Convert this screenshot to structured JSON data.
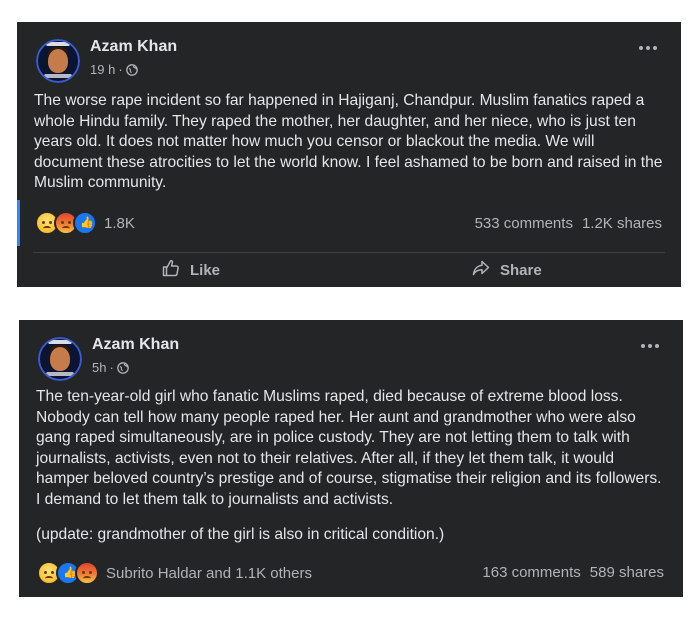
{
  "posts": [
    {
      "author": "Azam Khan",
      "time": "19 h",
      "separator": "·",
      "text": "The worse rape incident so far happened in Hajiganj, Chandpur. Muslim fanatics raped a whole Hindu family. They raped the mother, her daughter, and her niece, who is just ten years old. It does not matter how much you censor or blackout the media. We will document these atrocities to let the world know. I feel ashamed to be born and raised in the Muslim community.",
      "reaction_icons": [
        "sad-emoji-icon",
        "angry-emoji-icon",
        "like-emoji-icon"
      ],
      "reaction_count": "1.8K",
      "comments": "533 comments",
      "shares": "1.2K shares",
      "actions": {
        "like": "Like",
        "share": "Share"
      }
    },
    {
      "author": "Azam Khan",
      "time": "5h",
      "separator": "·",
      "text": "The ten-year-old girl who fanatic Muslims raped, died because of extreme blood loss. Nobody can tell how many people raped her. Her aunt and grandmother who were also gang raped simultaneously, are in police custody. They are not letting them to talk with journalists, activists, even not to their relatives. After all, if they let them talk, it would hamper beloved country’s prestige and of course, stigmatise their religion and its followers. I demand to let them talk to journalists and activists.",
      "update": "(update: grandmother of the girl is also in critical condition.)",
      "reaction_icons": [
        "sad-emoji-icon",
        "like-emoji-icon",
        "angry-emoji-icon"
      ],
      "reaction_count": "Subrito Haldar and 1.1K others",
      "comments": "163 comments",
      "shares": "589 shares"
    }
  ],
  "colors": {
    "card_bg": "#242526",
    "primary_text": "#e4e6eb",
    "secondary_text": "#b0b3b8",
    "accent": "#2d88ff"
  }
}
